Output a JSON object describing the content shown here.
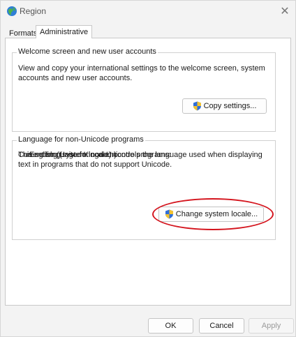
{
  "window": {
    "title": "Region",
    "close_glyph": "✕",
    "accent": "#d4141d"
  },
  "tabs": [
    {
      "label": "Formats",
      "active": false
    },
    {
      "label": "Administrative",
      "active": true
    }
  ],
  "welcome_group": {
    "label": "Welcome screen and new user accounts",
    "description": "View and copy your international settings to the welcome screen, system accounts and new user accounts.",
    "button_label": "Copy settings..."
  },
  "unicode_group": {
    "label": "Language for non-Unicode programs",
    "description": "This setting (system locale) controls the language used when displaying text in programs that do not support Unicode.",
    "current_label": "Current language for non-Unicode programs:",
    "current_value": "English (United Kingdom)",
    "button_label": "Change system locale..."
  },
  "footer": {
    "ok_label": "OK",
    "cancel_label": "Cancel",
    "apply_label": "Apply"
  },
  "icons": [
    "region-globe-icon",
    "close-icon",
    "uac-shield-icon"
  ]
}
